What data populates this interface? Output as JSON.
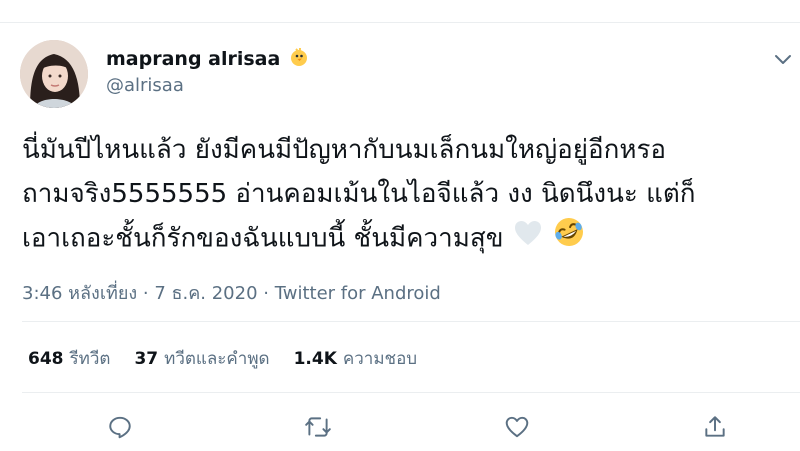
{
  "author": {
    "display_name": "maprang alrisaa",
    "name_emoji": "chick-emoji",
    "handle": "@alrisaa"
  },
  "tweet": {
    "lines": [
      "นี่มันปีไหนแล้ว ยังมีคนมีปัญหากับนมเล็กนมใหญ่อยู่อีกหรอ",
      "ถามจริง5555555 อ่านคอมเม้นในไอจีแล้ว งง นิดนึงนะ แต่ก็",
      "เอาเถอะชั้นก็รักของฉันแบบนี้ ชั้นมีความสุข"
    ],
    "emojis": [
      "white-heart-emoji",
      "rolling-on-floor-laughing-emoji"
    ]
  },
  "meta": {
    "time": "3:46 หลังเที่ยง",
    "separator1": " · ",
    "date": "7 ธ.ค. 2020",
    "separator2": " · ",
    "source": "Twitter for Android"
  },
  "stats": {
    "retweets_count": "648",
    "retweets_label": "รีทวีต",
    "quotes_count": "37",
    "quotes_label": "ทวีตและคำพูด",
    "likes_count": "1.4K",
    "likes_label": "ความชอบ"
  },
  "actions": [
    "reply-icon",
    "retweet-icon",
    "like-icon",
    "share-icon"
  ],
  "colors": {
    "text_primary": "#0f1419",
    "text_secondary": "#5b7083",
    "border": "#ebeef0"
  }
}
